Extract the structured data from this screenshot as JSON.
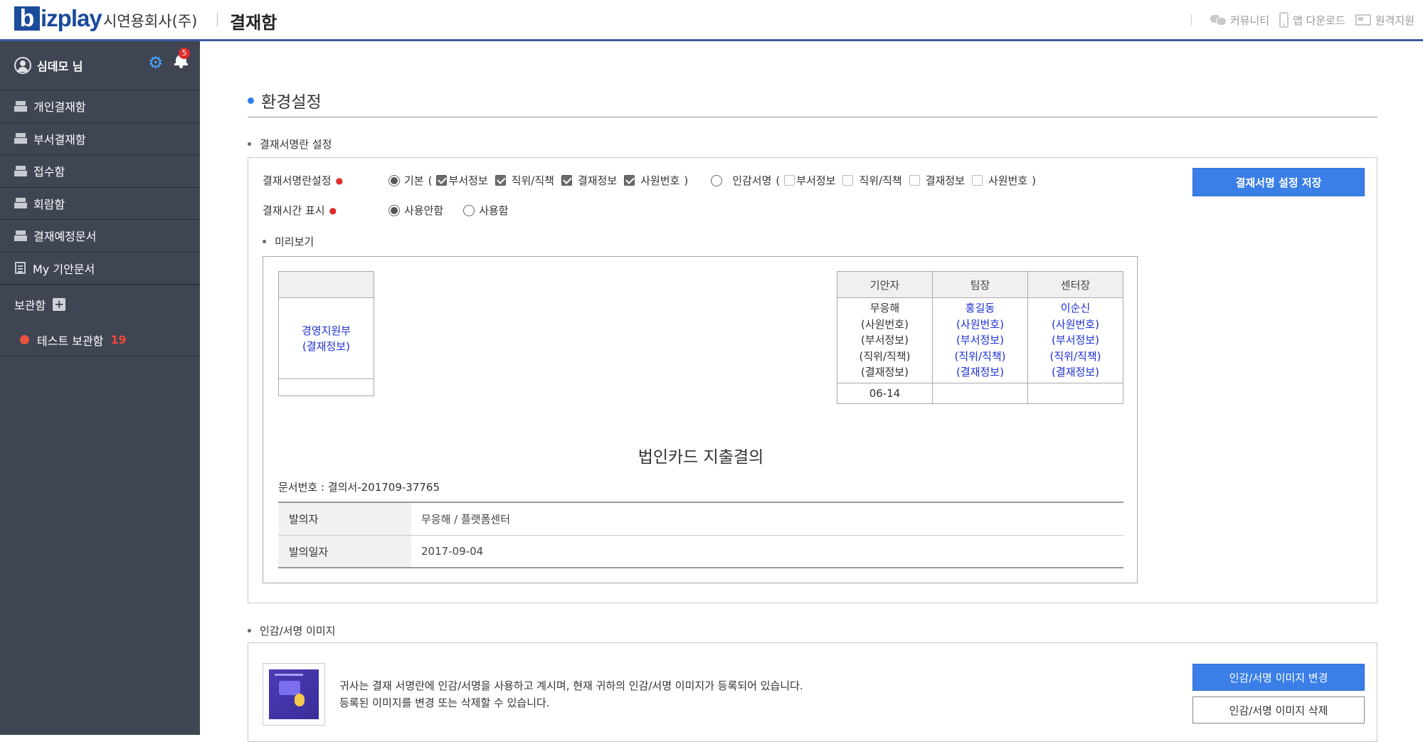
{
  "header": {
    "logo_initial": "b",
    "logo_rest": "izplay",
    "company": "시연용회사(주)",
    "app_title": "결재함",
    "links": [
      "커뮤니티",
      "앱 다운로드",
      "원격지원"
    ]
  },
  "sidebar": {
    "user": "심데모 님",
    "notification_count": "5",
    "items": [
      "개인결재함",
      "부서결재함",
      "접수함",
      "회람함",
      "결재예정문서",
      "My 기안문서"
    ],
    "box_title": "보관함",
    "boxes": [
      {
        "label": "테스트 보관함",
        "count": "19"
      }
    ]
  },
  "main": {
    "page_title": "환경설정",
    "sign_section": {
      "title": "결재서명란 설정",
      "row1_label": "결재서명란설정",
      "opt_basic": "기본",
      "opt_seal": "인감서명",
      "checks": [
        "부서정보",
        "직위/직책",
        "결재정보",
        "사원번호"
      ],
      "row2_label": "결재시간 표시",
      "time_off": "사용안함",
      "time_on": "사용함",
      "save_button": "결재서명 설정 저장",
      "preview_title": "미리보기"
    },
    "preview": {
      "dept_line1": "경영지원부",
      "dept_line2": "(결재정보)",
      "headers": [
        "기안자",
        "팀장",
        "센터장"
      ],
      "drafter": [
        "무응해",
        "(사원번호)",
        "(부서정보)",
        "(직위/직책)",
        "(결재정보)"
      ],
      "approver1": [
        "홍길동",
        "(사원번호)",
        "(부서정보)",
        "(직위/직책)",
        "(결재정보)"
      ],
      "approver2": [
        "이순신",
        "(사원번호)",
        "(부서정보)",
        "(직위/직책)",
        "(결재정보)"
      ],
      "date": "06-14",
      "doc_title": "법인카드 지출결의",
      "doc_no": "문서번호 : 결의서-201709-37765",
      "info": [
        {
          "k": "발의자",
          "v": "무응해 / 플랫폼센터"
        },
        {
          "k": "발의일자",
          "v": "2017-09-04"
        }
      ]
    },
    "seal_section": {
      "title": "인감/서명 이미지",
      "desc1": "귀사는 결재 서명란에 인감/서명을 사용하고 계시며, 현재 귀하의 인감/서명 이미지가 등록되어 있습니다.",
      "desc2": "등록된 이미지를 변경 또는 삭제할 수 있습니다.",
      "change_button": "인감/서명 이미지 변경",
      "delete_button": "인감/서명 이미지 삭제"
    }
  }
}
